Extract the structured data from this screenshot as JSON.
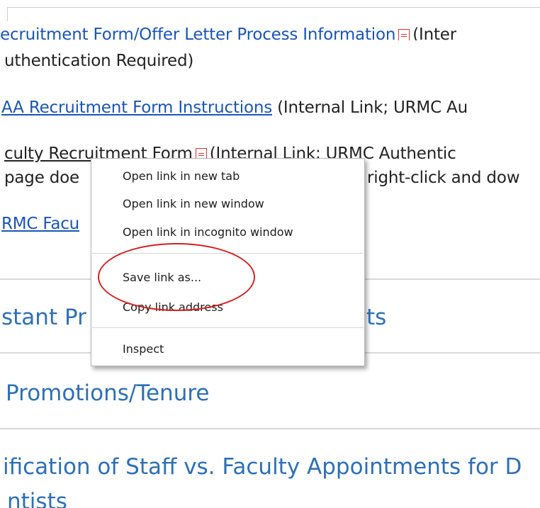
{
  "content": {
    "line1": {
      "link": "ecruitment Form/Offer Letter Process Information",
      "after": "(Inter"
    },
    "line2": {
      "text": "uthentication Required)"
    },
    "line3": {
      "link": "AA Recruitment Form Instructions",
      "after": "(Internal Link; URMC Au"
    },
    "line4": {
      "link": "culty Recruitment Form",
      "after": "(Internal Link; URMC Authentic"
    },
    "line5": {
      "before": "page doe",
      "after": "right-click and dow"
    },
    "line6": {
      "link": "RMC Facu"
    },
    "heading1": "stant Pr",
    "heading1_tail": "ts",
    "heading2": "Promotions/Tenure",
    "heading3": "ification of Staff vs. Faculty Appointments for D",
    "heading3_line2": "ntists"
  },
  "context_menu": {
    "items": [
      "Open link in new tab",
      "Open link in new window",
      "Open link in incognito window",
      "Save link as...",
      "Copy link address",
      "Inspect"
    ],
    "highlighted": "Save link as..."
  },
  "colors": {
    "link": "#1a55b5",
    "heading": "#2e6fb6",
    "annotation_circle": "#d42020"
  }
}
